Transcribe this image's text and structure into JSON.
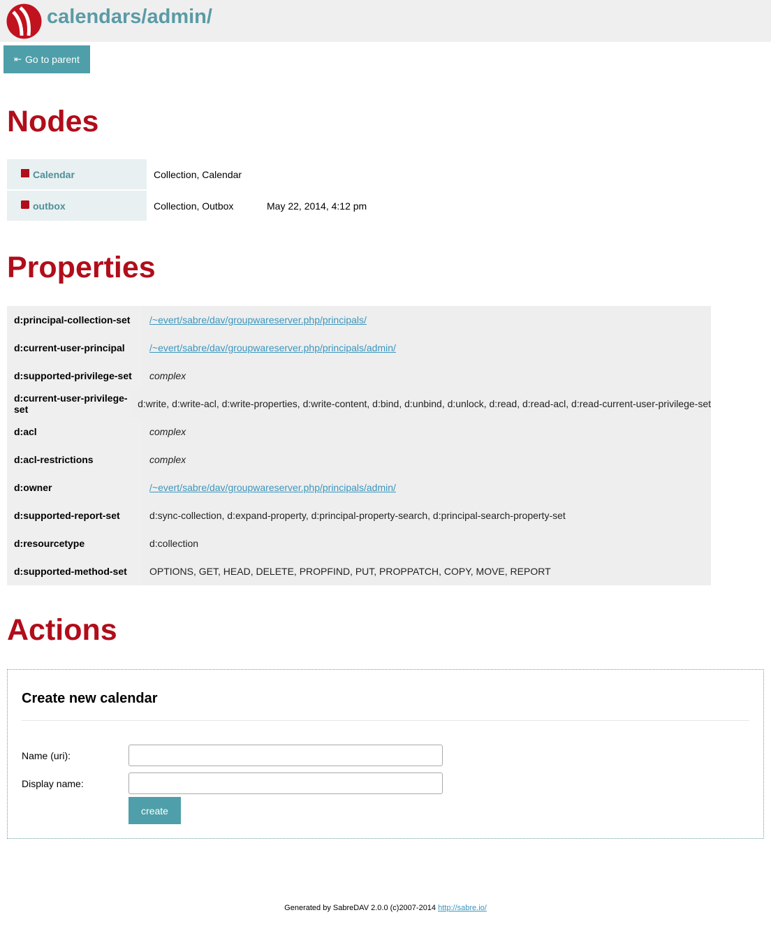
{
  "header": {
    "title": "calendars/admin/",
    "logo_icon": "sabredav-logo",
    "brand_color": "#b10d1a",
    "accent_color": "#4e9fa9"
  },
  "toolbar": {
    "parent_icon": "⇤",
    "parent_label": "Go to parent"
  },
  "sections": {
    "nodes": "Nodes",
    "properties": "Properties",
    "actions": "Actions"
  },
  "nodes": [
    {
      "name": "Calendar",
      "icon": "calendar-icon",
      "type": "Collection, Calendar",
      "modified": ""
    },
    {
      "name": "outbox",
      "icon": "outbox-icon",
      "type": "Collection, Outbox",
      "modified": "May 22, 2014, 4:12 pm"
    }
  ],
  "properties": [
    {
      "name": "d:principal-collection-set",
      "value": "/~evert/sabre/dav/groupwareserver.php/principals/",
      "kind": "link"
    },
    {
      "name": "d:current-user-principal",
      "value": "/~evert/sabre/dav/groupwareserver.php/principals/admin/",
      "kind": "link"
    },
    {
      "name": "d:supported-privilege-set",
      "value": "complex",
      "kind": "italic"
    },
    {
      "name": "d:current-user-privilege-set",
      "value": "d:write, d:write-acl, d:write-properties, d:write-content, d:bind, d:unbind, d:unlock, d:read, d:read-acl, d:read-current-user-privilege-set",
      "kind": "text"
    },
    {
      "name": "d:acl",
      "value": "complex",
      "kind": "italic"
    },
    {
      "name": "d:acl-restrictions",
      "value": "complex",
      "kind": "italic"
    },
    {
      "name": "d:owner",
      "value": "/~evert/sabre/dav/groupwareserver.php/principals/admin/",
      "kind": "link"
    },
    {
      "name": "d:supported-report-set",
      "value": "d:sync-collection, d:expand-property, d:principal-property-search, d:principal-search-property-set",
      "kind": "text"
    },
    {
      "name": "d:resourcetype",
      "value": "d:collection",
      "kind": "text"
    },
    {
      "name": "d:supported-method-set",
      "value": "OPTIONS, GET, HEAD, DELETE, PROPFIND, PUT, PROPPATCH, COPY, MOVE, REPORT",
      "kind": "text"
    }
  ],
  "create_calendar": {
    "title": "Create new calendar",
    "name_label": "Name (uri):",
    "name_value": "",
    "display_label": "Display name:",
    "display_value": "",
    "submit_label": "create"
  },
  "footer": {
    "text": "Generated by SabreDAV 2.0.0 (c)2007-2014 ",
    "link": "http://sabre.io/"
  }
}
